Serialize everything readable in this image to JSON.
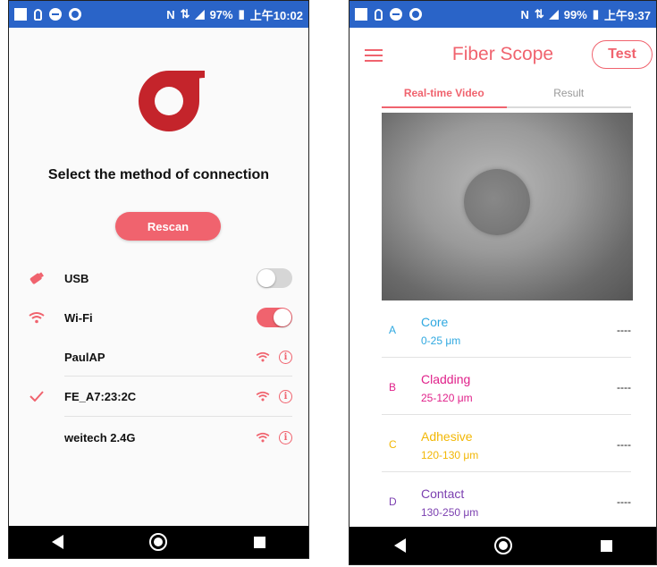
{
  "left_phone": {
    "status_bar": {
      "battery": "97%",
      "time": "上午10:02",
      "icons": [
        "square-icon",
        "bulb-icon",
        "dnd-icon",
        "circle-icon",
        "nfc-icon",
        "wifi-icon",
        "signal-icon",
        "battery-icon"
      ]
    },
    "title": "Select the method of connection",
    "rescan_label": "Rescan",
    "connections": [
      {
        "name": "USB",
        "icon": "usb-icon",
        "toggle": "off"
      },
      {
        "name": "Wi-Fi",
        "icon": "wifi-icon",
        "toggle": "on"
      }
    ],
    "networks": [
      {
        "ssid": "PaulAP",
        "connected": false
      },
      {
        "ssid": "FE_A7:23:2C",
        "connected": true
      },
      {
        "ssid": "weitech 2.4G",
        "connected": false
      }
    ],
    "accent_color": "#f0636e",
    "logo_color": "#c4242b"
  },
  "right_phone": {
    "status_bar": {
      "battery": "99%",
      "time": "上午9:37"
    },
    "app_title": "Fiber Scope",
    "test_label": "Test",
    "tabs": [
      {
        "label": "Real-time Video",
        "active": true
      },
      {
        "label": "Result",
        "active": false
      }
    ],
    "zones": [
      {
        "letter": "A",
        "name": "Core",
        "range": "0-25 μm",
        "value": "----",
        "color": "#2fa8e0"
      },
      {
        "letter": "B",
        "name": "Cladding",
        "range": "25-120 μm",
        "value": "----",
        "color": "#e0218a"
      },
      {
        "letter": "C",
        "name": "Adhesive",
        "range": "120-130 μm",
        "value": "----",
        "color": "#f2b705"
      },
      {
        "letter": "D",
        "name": "Contact",
        "range": "130-250 μm",
        "value": "----",
        "color": "#7b3fb0"
      }
    ]
  }
}
